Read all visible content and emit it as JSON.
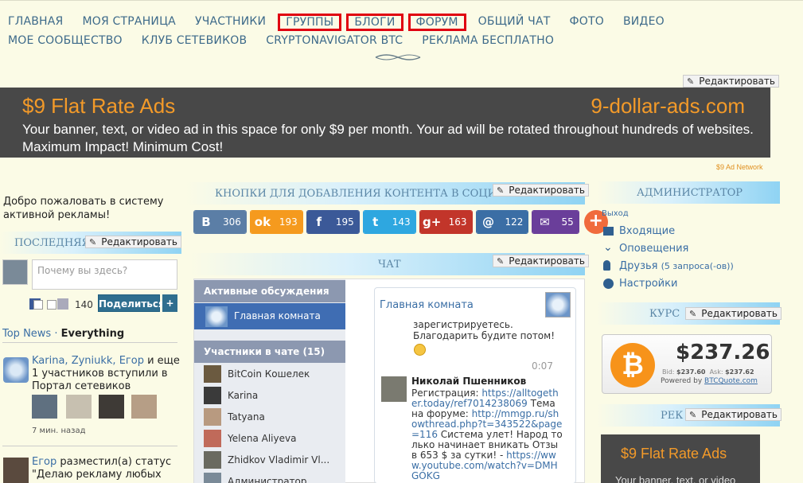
{
  "nav": {
    "row1": [
      "ГЛАВНАЯ",
      "МОЯ СТРАНИЦА",
      "УЧАСТНИКИ",
      "ГРУППЫ",
      "БЛОГИ",
      "ФОРУМ",
      "ОБЩИЙ ЧАТ",
      "ФОТО",
      "ВИДЕО"
    ],
    "row2": [
      "МОЕ СООБЩЕСТВО",
      "КЛУБ СЕТЕВИКОВ",
      "CRYPTONAVIGATOR BTC",
      "РЕКЛАМА БЕСПЛАТНО"
    ]
  },
  "edit_label": "Редактировать",
  "banner": {
    "title": "$9 Flat Rate Ads",
    "site": "9-dollar-ads.com",
    "text": "Your banner, text, or video ad in this space for only $9 per month. Your ad will be rotated throughout hundreds of websites. Maximum Impact! Minimum Cost!",
    "network": "$9 Ad Network"
  },
  "left": {
    "welcome": "Добро пожаловать в систему активной рекламы!",
    "section_title": "ПОСЛЕДНЯЯ",
    "status_placeholder": "Почему вы здесь?",
    "share_count": "140",
    "share_button": "Поделиться",
    "share_plus": "+",
    "top_news": "Top News",
    "separator": "·",
    "everything": "Everything",
    "feed1_users": "Karina, Zyniukk, Егор",
    "feed1_text": " и еще 1 участников вступили в Портал сетевиков",
    "feed1_time": "7 мин. назад",
    "feed2_user": "Егор",
    "feed2_text": " разместил(а) статус \"Делаю рекламу любых"
  },
  "middle": {
    "buttons_title": "КНОПКИ ДЛЯ ДОБАВЛЕНИЯ КОНТЕНТА В СОЦИАЛ",
    "social": [
      {
        "icon": "vk-icon",
        "glyph": "B",
        "count": "306",
        "color": "#5b7ea6"
      },
      {
        "icon": "odnoklassniki-icon",
        "glyph": "ok",
        "count": "193",
        "color": "#f59a1e"
      },
      {
        "icon": "facebook-icon",
        "glyph": "f",
        "count": "195",
        "color": "#3b5998"
      },
      {
        "icon": "twitter-icon",
        "glyph": "t",
        "count": "143",
        "color": "#2ea7e0"
      },
      {
        "icon": "google-plus-icon",
        "glyph": "g+",
        "count": "163",
        "color": "#c2352a"
      },
      {
        "icon": "mail-ru-icon",
        "glyph": "@",
        "count": "122",
        "color": "#3b6ea5"
      },
      {
        "icon": "email-icon",
        "glyph": "✉",
        "count": "55",
        "color": "#6a3e9a"
      }
    ],
    "social_plus": "+",
    "chat_title": "ЧАТ",
    "active_discussions": "Активные обсуждения",
    "main_room": "Главная комната",
    "members_title": "Участники в чате (15)",
    "members": [
      "BitCoin Кошелек",
      "Karina",
      "Tatyana",
      "Yelena Aliyeva",
      "Zhidkov Vladimir Vl...",
      "Администратор"
    ],
    "room_title": "Главная комната",
    "msg1": "зарегистрируетесь. Благодарить будите потом!",
    "msg_time": "0:07",
    "msg2_author": "Николай Пшенников",
    "msg2_prefix": "Регистрация: ",
    "msg2_link1": "https://alltogether.today/ref7014238069",
    "msg2_mid": " Тема на форуме: ",
    "msg2_link2": "http://mmgp.ru/showthread.php?t=343522&page=116",
    "msg2_suffix": " Система улет! Народ только начинает вникать Отзыв 653 $ за сутки! - ",
    "msg2_link3": "https://www.youtube.com/watch?v=DMHGOKG"
  },
  "right": {
    "admin_title": "АДМИНИСТРАТОР",
    "exit": "Выход",
    "inbox": "Входящие",
    "alerts": "Оповещения",
    "friends": "Друзья",
    "friends_sub": "(5 запроса(-ов))",
    "settings": "Настройки",
    "course_title": "КУРС",
    "btc_price": "$237.26",
    "bid_label": "Bid:",
    "bid": "$237.60",
    "ask_label": "Ask:",
    "ask": "$237.62",
    "powered_by": "Powered by",
    "powered_site": "BTCQuote.com",
    "ad_title_short": "РЕК",
    "ad_title": "$9 Flat Rate Ads",
    "ad_text": "Your banner, text, or video"
  }
}
